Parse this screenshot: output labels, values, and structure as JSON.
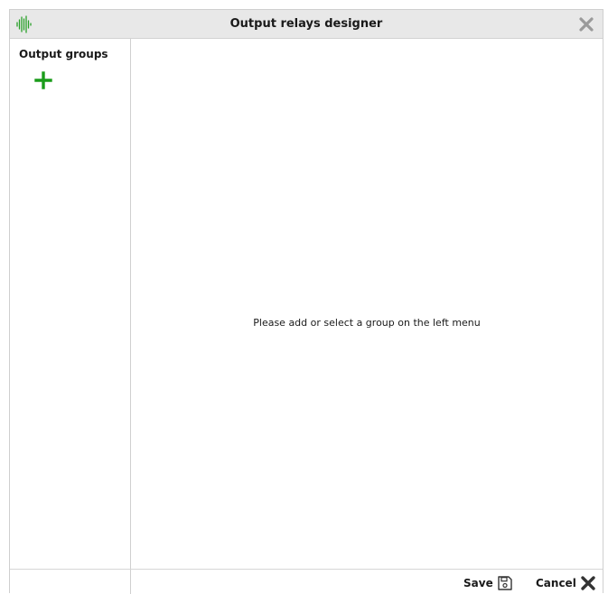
{
  "window": {
    "title": "Output relays designer"
  },
  "sidebar": {
    "title": "Output groups"
  },
  "main": {
    "placeholder": "Please add or select a group on the left menu"
  },
  "footer": {
    "save_label": "Save",
    "cancel_label": "Cancel"
  },
  "icons": {
    "app": "waveform-icon",
    "close": "close-icon",
    "add": "plus-icon",
    "save": "floppy-disk-icon",
    "cancel": "x-icon"
  },
  "colors": {
    "accent_green": "#1a9c1a",
    "title_bar": "#e8e8e8",
    "close_gray": "#9a9a9a"
  }
}
